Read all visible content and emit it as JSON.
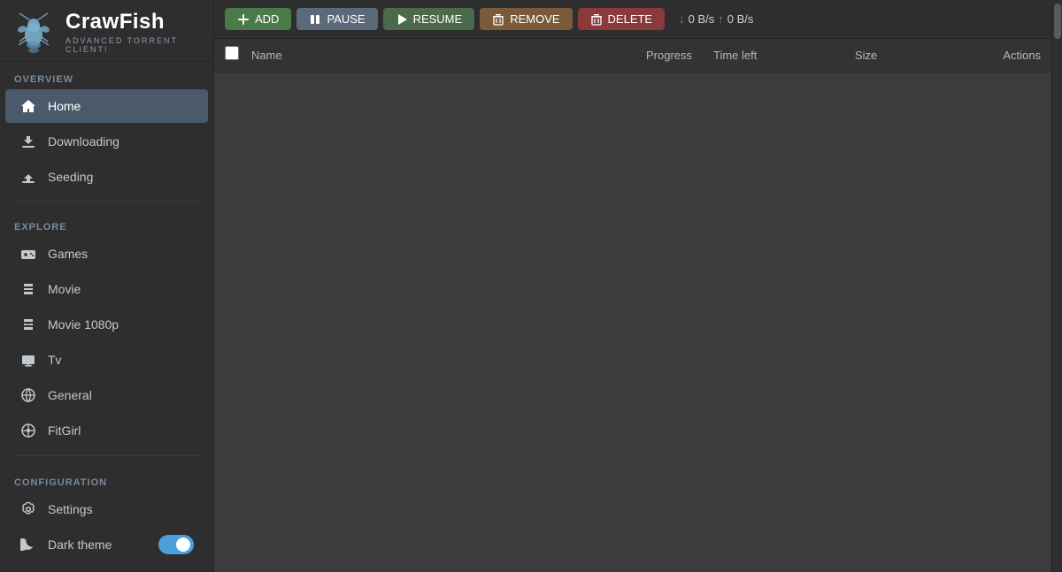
{
  "app": {
    "title": "CrawFish",
    "subtitle": "ADVANCED TORRENT CLIENT!",
    "logo_alt": "CrawFish logo"
  },
  "sidebar": {
    "overview_label": "Overview",
    "explore_label": "Explore",
    "configuration_label": "Configuration",
    "nav_items": [
      {
        "id": "home",
        "label": "Home",
        "icon": "home-icon",
        "active": true
      },
      {
        "id": "downloading",
        "label": "Downloading",
        "icon": "download-icon",
        "active": false
      },
      {
        "id": "seeding",
        "label": "Seeding",
        "icon": "upload-icon",
        "active": false
      }
    ],
    "explore_items": [
      {
        "id": "games",
        "label": "Games",
        "icon": "games-icon"
      },
      {
        "id": "movie",
        "label": "Movie",
        "icon": "movie-icon"
      },
      {
        "id": "movie1080p",
        "label": "Movie 1080p",
        "icon": "movie-hd-icon"
      },
      {
        "id": "tv",
        "label": "Tv",
        "icon": "tv-icon"
      },
      {
        "id": "general",
        "label": "General",
        "icon": "general-icon"
      },
      {
        "id": "fitgirl",
        "label": "FitGirl",
        "icon": "fitgirl-icon"
      }
    ],
    "config_items": [
      {
        "id": "settings",
        "label": "Settings",
        "icon": "settings-icon"
      },
      {
        "id": "darktheme",
        "label": "Dark theme",
        "icon": "moon-icon",
        "has_toggle": true,
        "toggle_value": true
      }
    ]
  },
  "toolbar": {
    "add_label": "ADD",
    "pause_label": "PAUSE",
    "resume_label": "RESUME",
    "remove_label": "REMOVE",
    "delete_label": "DELETE",
    "speed_down": "0 B/s",
    "speed_up": "0 B/s"
  },
  "table": {
    "columns": [
      "Name",
      "Progress",
      "Time left",
      "Size",
      "Actions"
    ],
    "rows": []
  }
}
